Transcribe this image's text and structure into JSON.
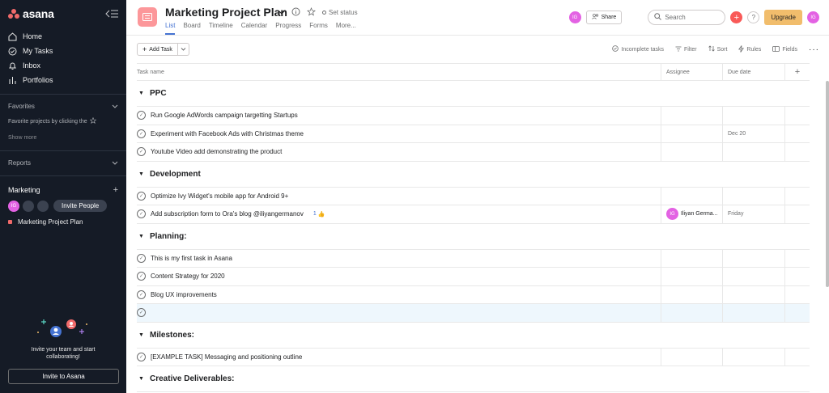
{
  "sidebar": {
    "logo": "asana",
    "nav": [
      {
        "label": "Home",
        "icon": "home-icon"
      },
      {
        "label": "My Tasks",
        "icon": "check-circle-icon"
      },
      {
        "label": "Inbox",
        "icon": "bell-icon"
      },
      {
        "label": "Portfolios",
        "icon": "bar-chart-icon"
      }
    ],
    "favorites_label": "Favorites",
    "favorites_hint": "Favorite projects by clicking the",
    "show_more": "Show more",
    "reports_label": "Reports",
    "team_label": "Marketing",
    "user_initials": "IG",
    "invite_people": "Invite People",
    "project": "Marketing Project Plan",
    "invite_text_1": "Invite your team and start",
    "invite_text_2": "collaborating!",
    "invite_button": "Invite to Asana"
  },
  "header": {
    "title": "Marketing Project Plan",
    "set_status": "Set status",
    "tabs": [
      "List",
      "Board",
      "Timeline",
      "Calendar",
      "Progress",
      "Forms",
      "More..."
    ],
    "active_tab": "List",
    "user_initials": "IG",
    "share": "Share",
    "search_placeholder": "Search",
    "help": "?",
    "upgrade": "Upgrade",
    "upgrade_color": "#f1bd6c"
  },
  "toolbar": {
    "add_task": "Add Task",
    "incomplete": "Incomplete tasks",
    "filter": "Filter",
    "sort": "Sort",
    "rules": "Rules",
    "fields": "Fields"
  },
  "table": {
    "headers": {
      "name": "Task name",
      "assignee": "Assignee",
      "due": "Due date"
    },
    "sections": [
      {
        "title": "PPC",
        "tasks": [
          {
            "name": "Run Google AdWords campaign targetting Startups",
            "assignee": "",
            "due": "",
            "likes": ""
          },
          {
            "name": "Experiment with Facebook Ads with Christmas theme",
            "assignee": "",
            "due": "Dec 20",
            "likes": ""
          },
          {
            "name": "Youtube Video add demonstrating the product",
            "assignee": "",
            "due": "",
            "likes": ""
          }
        ]
      },
      {
        "title": "Development",
        "tasks": [
          {
            "name": "Optimize Ivy Widget's mobile app for Android 9+",
            "assignee": "",
            "due": "",
            "likes": ""
          },
          {
            "name": "Add subscription form to Ora's blog @iliyangermanov",
            "assignee": "Iliyan Germa...",
            "assignee_initials": "IG",
            "due": "Friday",
            "likes": "1"
          }
        ]
      },
      {
        "title": "Planning:",
        "tasks": [
          {
            "name": "This is my first task in Asana",
            "assignee": "",
            "due": "",
            "likes": ""
          },
          {
            "name": "Content Strategy for 2020",
            "assignee": "",
            "due": "",
            "likes": ""
          },
          {
            "name": "Blog UX improvements",
            "assignee": "",
            "due": "",
            "likes": ""
          },
          {
            "name": "",
            "assignee": "",
            "due": "",
            "likes": "",
            "highlight": true
          }
        ]
      },
      {
        "title": "Milestones:",
        "tasks": [
          {
            "name": "[EXAMPLE TASK] Messaging and positioning outline",
            "assignee": "",
            "due": "",
            "likes": ""
          }
        ]
      },
      {
        "title": "Creative Deliverables:",
        "tasks": []
      }
    ]
  }
}
